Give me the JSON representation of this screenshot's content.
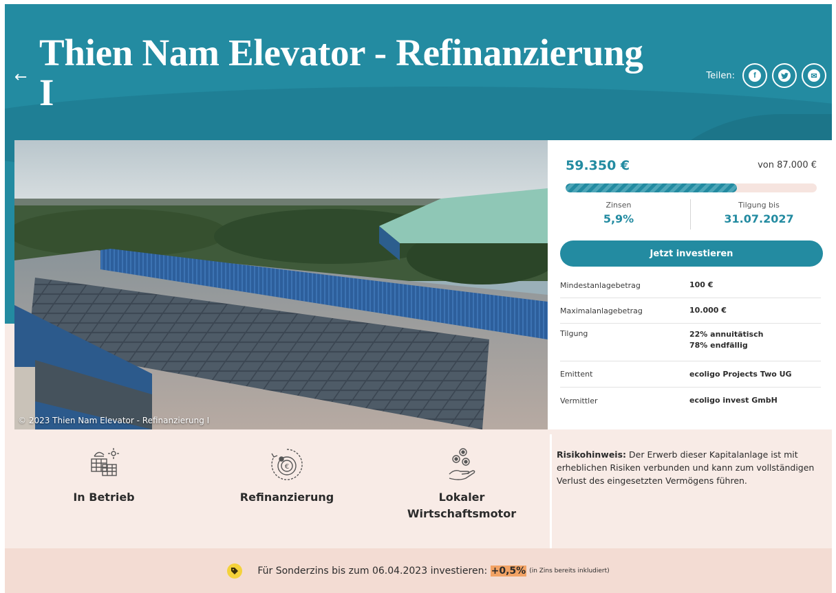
{
  "header": {
    "back_icon": "arrow-left-icon",
    "title": "Thien Nam Elevator - Refinanzierung I",
    "share_label": "Teilen:",
    "share_buttons": [
      {
        "icon": "facebook-icon",
        "glyph": "f"
      },
      {
        "icon": "twitter-icon",
        "glyph": "t"
      },
      {
        "icon": "email-icon",
        "glyph": "✉"
      }
    ]
  },
  "photo": {
    "caption": "© 2023 Thien Nam Elevator - Refinanzierung I"
  },
  "funding": {
    "amount": "59.350 €",
    "goal": "von 87.000 €",
    "progress_fraction": 0.682,
    "interest_label": "Zinsen",
    "interest_value": "5,9%",
    "repayment_label": "Tilgung bis",
    "repayment_value": "31.07.2027",
    "invest_button": "Jetzt investieren"
  },
  "facts": [
    {
      "key": "Mindestanlagebetrag",
      "value": "100 €"
    },
    {
      "key": "Maximalanlagebetrag",
      "value": "10.000 €"
    },
    {
      "key": "Tilgung",
      "value": "22% annuitätisch",
      "value2": "78% endfällig"
    },
    {
      "key": "Emittent",
      "value": "ecoligo Projects Two UG"
    },
    {
      "key": "Vermittler",
      "value": "ecoligo invest GmbH"
    }
  ],
  "features": [
    {
      "icon": "solar-panel-icon",
      "label": "In Betrieb"
    },
    {
      "icon": "refinance-coin-icon",
      "label": "Refinanzierung"
    },
    {
      "icon": "coins-hand-icon",
      "label": "Lokaler Wirtschaftsmotor"
    }
  ],
  "risk": {
    "title": "Risikohinweis:",
    "text": " Der Erwerb dieser Kapitalanlage ist mit erheblichen Risiken verbunden und kann zum vollständigen Verlust des eingesetzten Vermögens führen."
  },
  "promo": {
    "icon": "tag-icon",
    "text": "Für Sonderzins bis zum 06.04.2023 investieren: ",
    "bonus": "+0,5%",
    "note": "(in Zins bereits inkludiert)"
  },
  "colors": {
    "brand": "#238ba1",
    "background": "#f8ebe6",
    "promo_highlight": "#f2a365",
    "promo_icon": "#f4d23b"
  }
}
